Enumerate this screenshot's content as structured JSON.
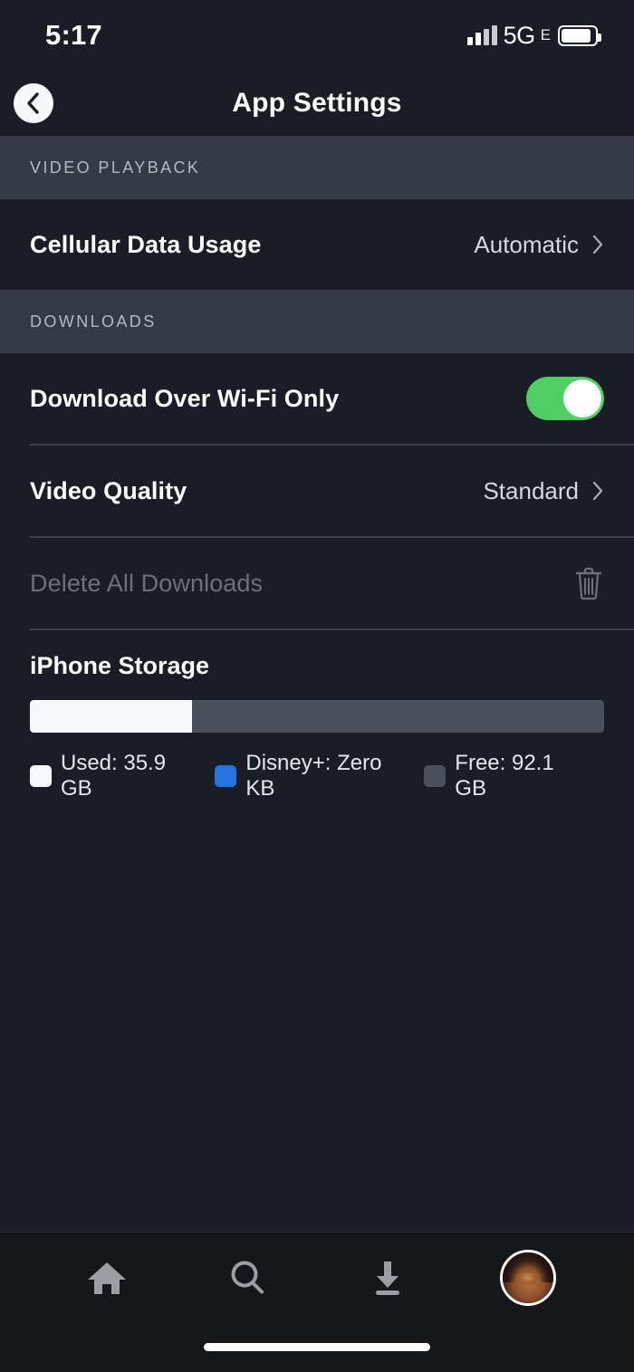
{
  "status_bar": {
    "time": "5:17",
    "network_label": "5G",
    "network_suffix": "E",
    "signal_icon": "cellular-signal-icon",
    "battery_icon": "battery-icon"
  },
  "nav": {
    "back_icon": "chevron-left-icon",
    "title": "App Settings"
  },
  "sections": [
    {
      "header": "VIDEO PLAYBACK",
      "rows": [
        {
          "label": "Cellular Data Usage",
          "value": "Automatic",
          "accessory": "chevron-right-icon",
          "type": "disclosure"
        }
      ]
    },
    {
      "header": "DOWNLOADS",
      "rows": [
        {
          "label": "Download Over Wi-Fi Only",
          "value": "On",
          "accessory": "toggle-switch",
          "type": "toggle"
        },
        {
          "label": "Video Quality",
          "value": "Standard",
          "accessory": "chevron-right-icon",
          "type": "disclosure"
        },
        {
          "label": "Delete All Downloads",
          "value": "",
          "accessory": "trash-icon",
          "type": "action-disabled"
        }
      ]
    }
  ],
  "storage": {
    "title": "iPhone Storage",
    "used_percent": 28.2,
    "app_percent": 0,
    "legend": [
      {
        "label": "Used: 35.9 GB",
        "color": "#f7f8fa"
      },
      {
        "label": "Disney+: Zero KB",
        "color": "#2374e1"
      },
      {
        "label": "Free: 92.1 GB",
        "color": "#4a4f5c"
      }
    ]
  },
  "tabbar": {
    "tabs": [
      {
        "icon": "home-icon",
        "label": "Home"
      },
      {
        "icon": "search-icon",
        "label": "Search"
      },
      {
        "icon": "download-icon",
        "label": "Downloads"
      },
      {
        "icon": "profile-avatar",
        "label": "Profile"
      }
    ]
  },
  "colors": {
    "background": "#1a1d26",
    "section_header_bg": "#353a44",
    "toggle_on": "#4ecf63",
    "accent_blue": "#2374e1",
    "disabled_text": "#6b707c"
  }
}
